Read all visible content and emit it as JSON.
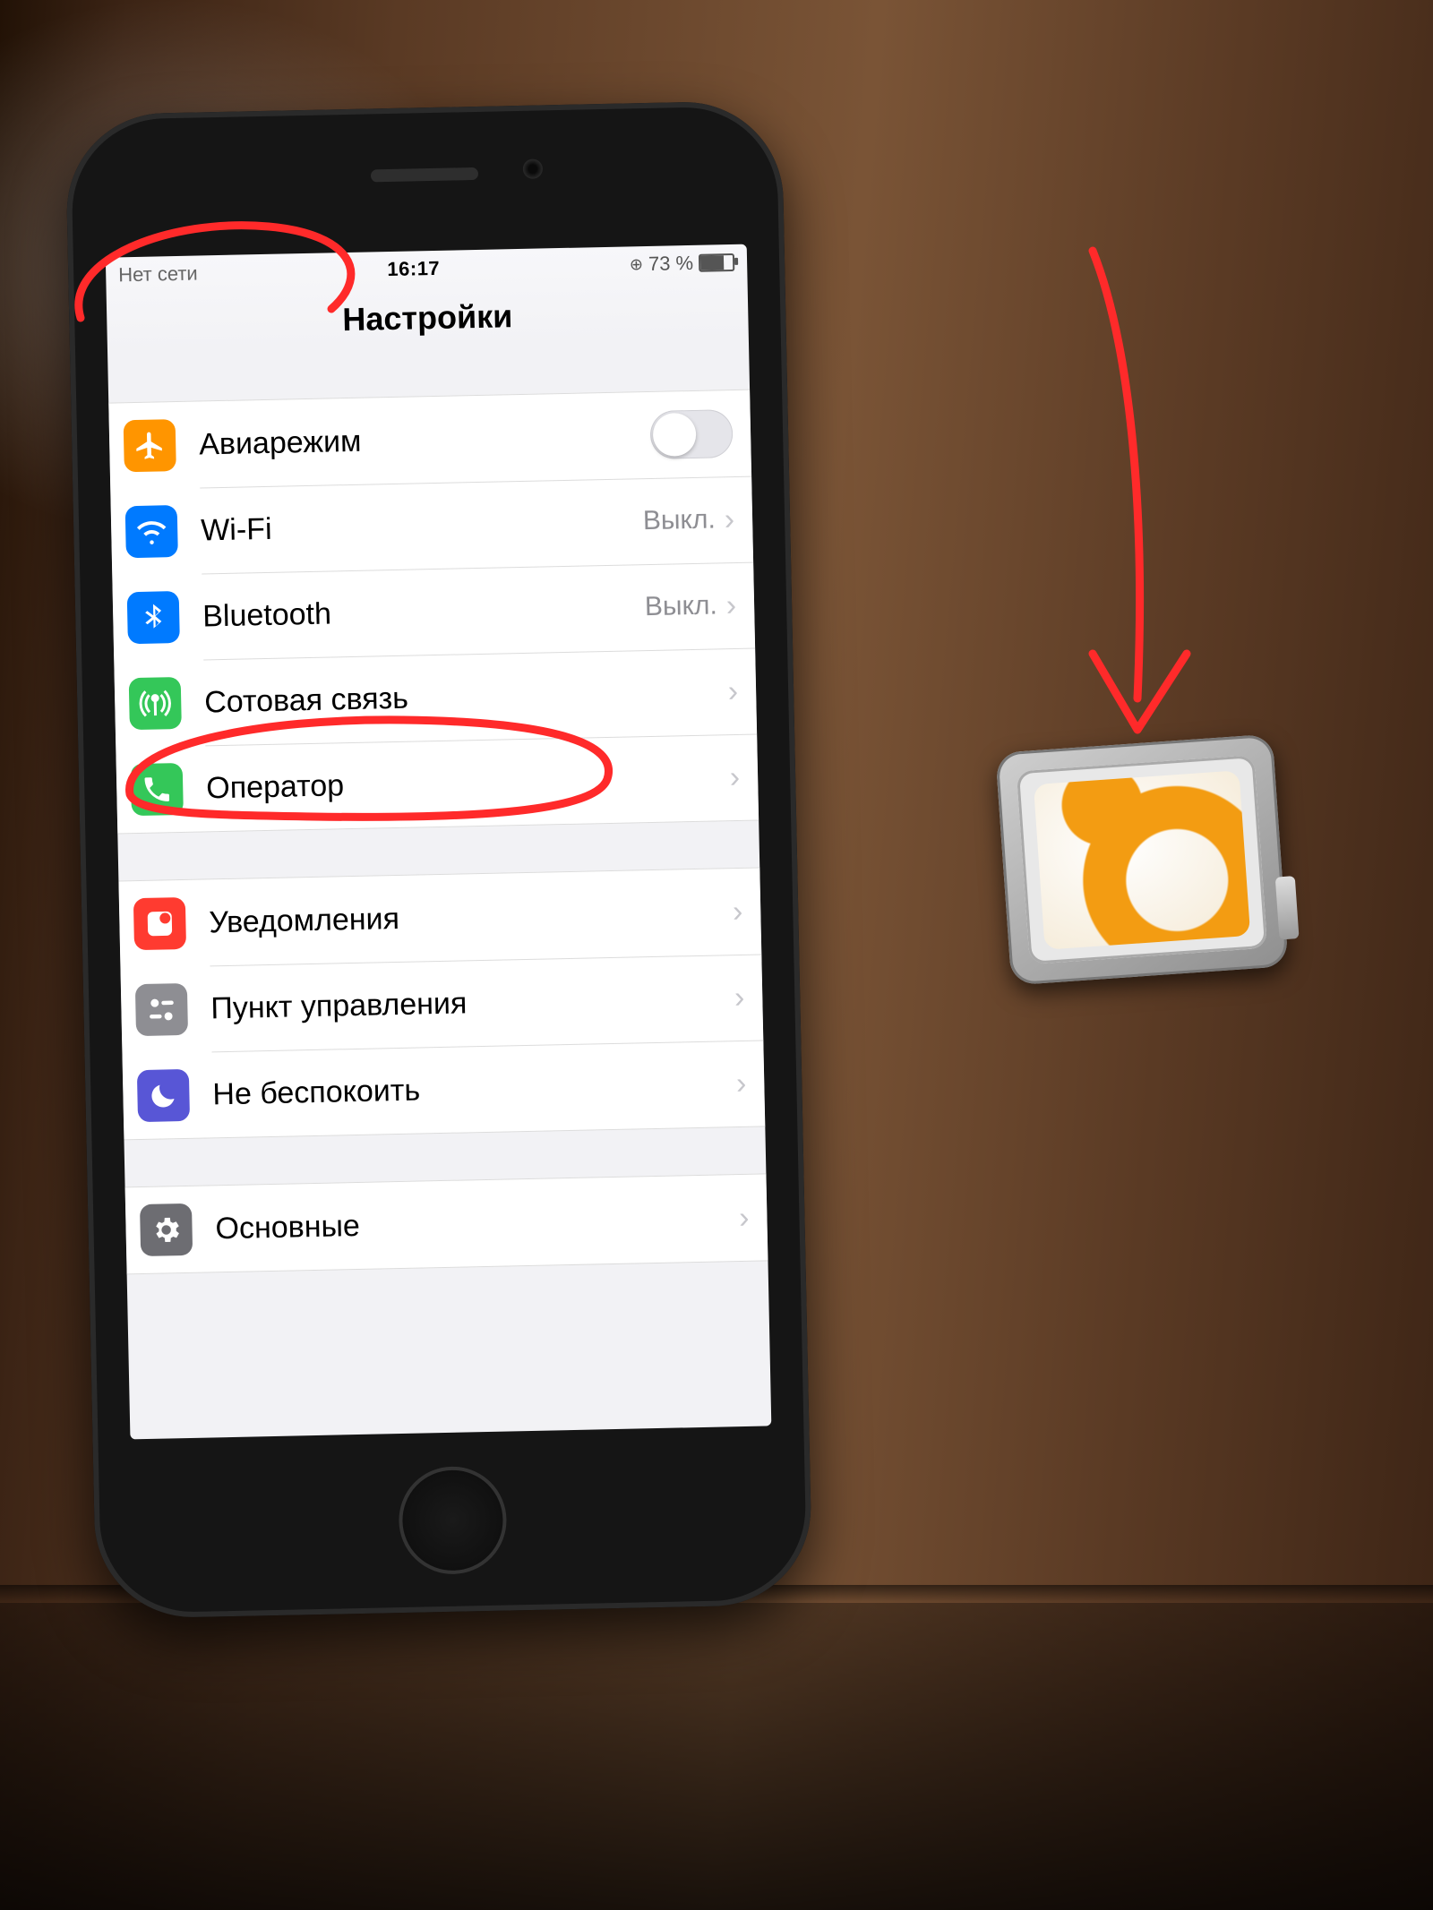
{
  "status": {
    "network": "Нет сети",
    "time": "16:17",
    "battery_pct": "73 %",
    "lock_glyph": "⊕"
  },
  "page_title": "Настройки",
  "value_off": "Выкл.",
  "groups": [
    {
      "rows": [
        {
          "id": "airplane",
          "label": "Авиарежим",
          "icon": "airplane-icon",
          "bg": "bg-orange",
          "accessory": "toggle"
        },
        {
          "id": "wifi",
          "label": "Wi-Fi",
          "icon": "wifi-icon",
          "bg": "bg-blue",
          "accessory": "value",
          "value_key": "value_off"
        },
        {
          "id": "bluetooth",
          "label": "Bluetooth",
          "icon": "bluetooth-icon",
          "bg": "bg-blue",
          "accessory": "value",
          "value_key": "value_off"
        },
        {
          "id": "cellular",
          "label": "Сотовая связь",
          "icon": "antenna-icon",
          "bg": "bg-green",
          "accessory": "chev"
        },
        {
          "id": "carrier",
          "label": "Оператор",
          "icon": "phone-icon",
          "bg": "bg-green",
          "accessory": "chev"
        }
      ]
    },
    {
      "rows": [
        {
          "id": "notifications",
          "label": "Уведомления",
          "icon": "notification-icon",
          "bg": "bg-red",
          "accessory": "chev"
        },
        {
          "id": "controlcenter",
          "label": "Пункт управления",
          "icon": "controls-icon",
          "bg": "bg-ggray",
          "accessory": "chev"
        },
        {
          "id": "dnd",
          "label": "Не беспокоить",
          "icon": "moon-icon",
          "bg": "bg-indigo",
          "accessory": "chev"
        }
      ]
    },
    {
      "rows": [
        {
          "id": "general",
          "label": "Основные",
          "icon": "gear-icon",
          "bg": "bg-dgray",
          "accessory": "chev"
        }
      ]
    }
  ],
  "annotations": {
    "no_service_circled": true,
    "carrier_circled": true,
    "arrow_to_sim_tray": true
  }
}
